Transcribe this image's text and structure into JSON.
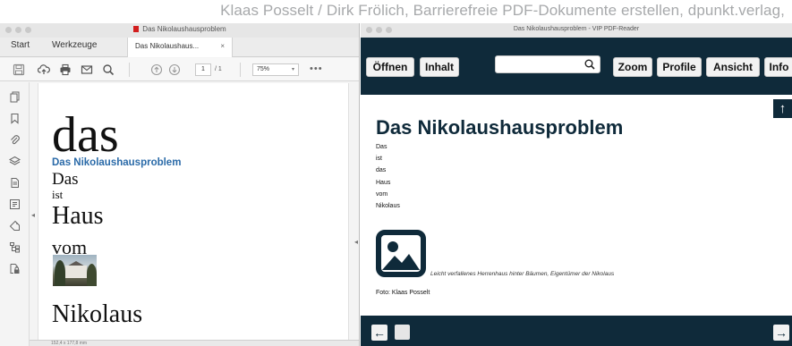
{
  "credit": "Klaas Posselt / Dirk Frölich, Barrierefreie PDF-Dokumente erstellen, dpunkt.verlag,",
  "acrobat": {
    "window_title": "Das Nikolaushausproblem",
    "tabs": {
      "start": "Start",
      "werkzeuge": "Werkzeuge",
      "doc": "Das Nikolaushaus...",
      "close": "×"
    },
    "toolbar": {
      "page_current": "1",
      "page_total": "/ 1",
      "zoom": "75%",
      "more": "•••"
    },
    "page": {
      "das_big": "das",
      "heading": "Das Nikolaushausproblem",
      "das": "Das",
      "ist": "ist",
      "haus": "Haus",
      "vom": "vom",
      "nikolaus": "Nikolaus"
    },
    "statusbar": "152,4 x 177,8 mm"
  },
  "vip": {
    "window_title": "Das Nikolaushausproblem - VIP PDF-Reader",
    "buttons": {
      "open": "Öffnen",
      "content": "Inhalt",
      "zoom": "Zoom",
      "profile": "Profile",
      "view": "Ansicht",
      "info": "Info"
    },
    "heading": "Das Nikolaushausproblem",
    "words": [
      "Das",
      "ist",
      "das",
      "Haus",
      "vom",
      "Nikolaus"
    ],
    "caption": "Leicht verfallenes Herrenhaus hinter Bäumen, Eigentümer der Nikolaus",
    "foto": "Foto: Klaas Posselt",
    "up": "↑",
    "prev": "←",
    "next": "→"
  },
  "colors": {
    "vip_dark": "#0f2a3a",
    "heading_blue": "#2a6aa8"
  }
}
